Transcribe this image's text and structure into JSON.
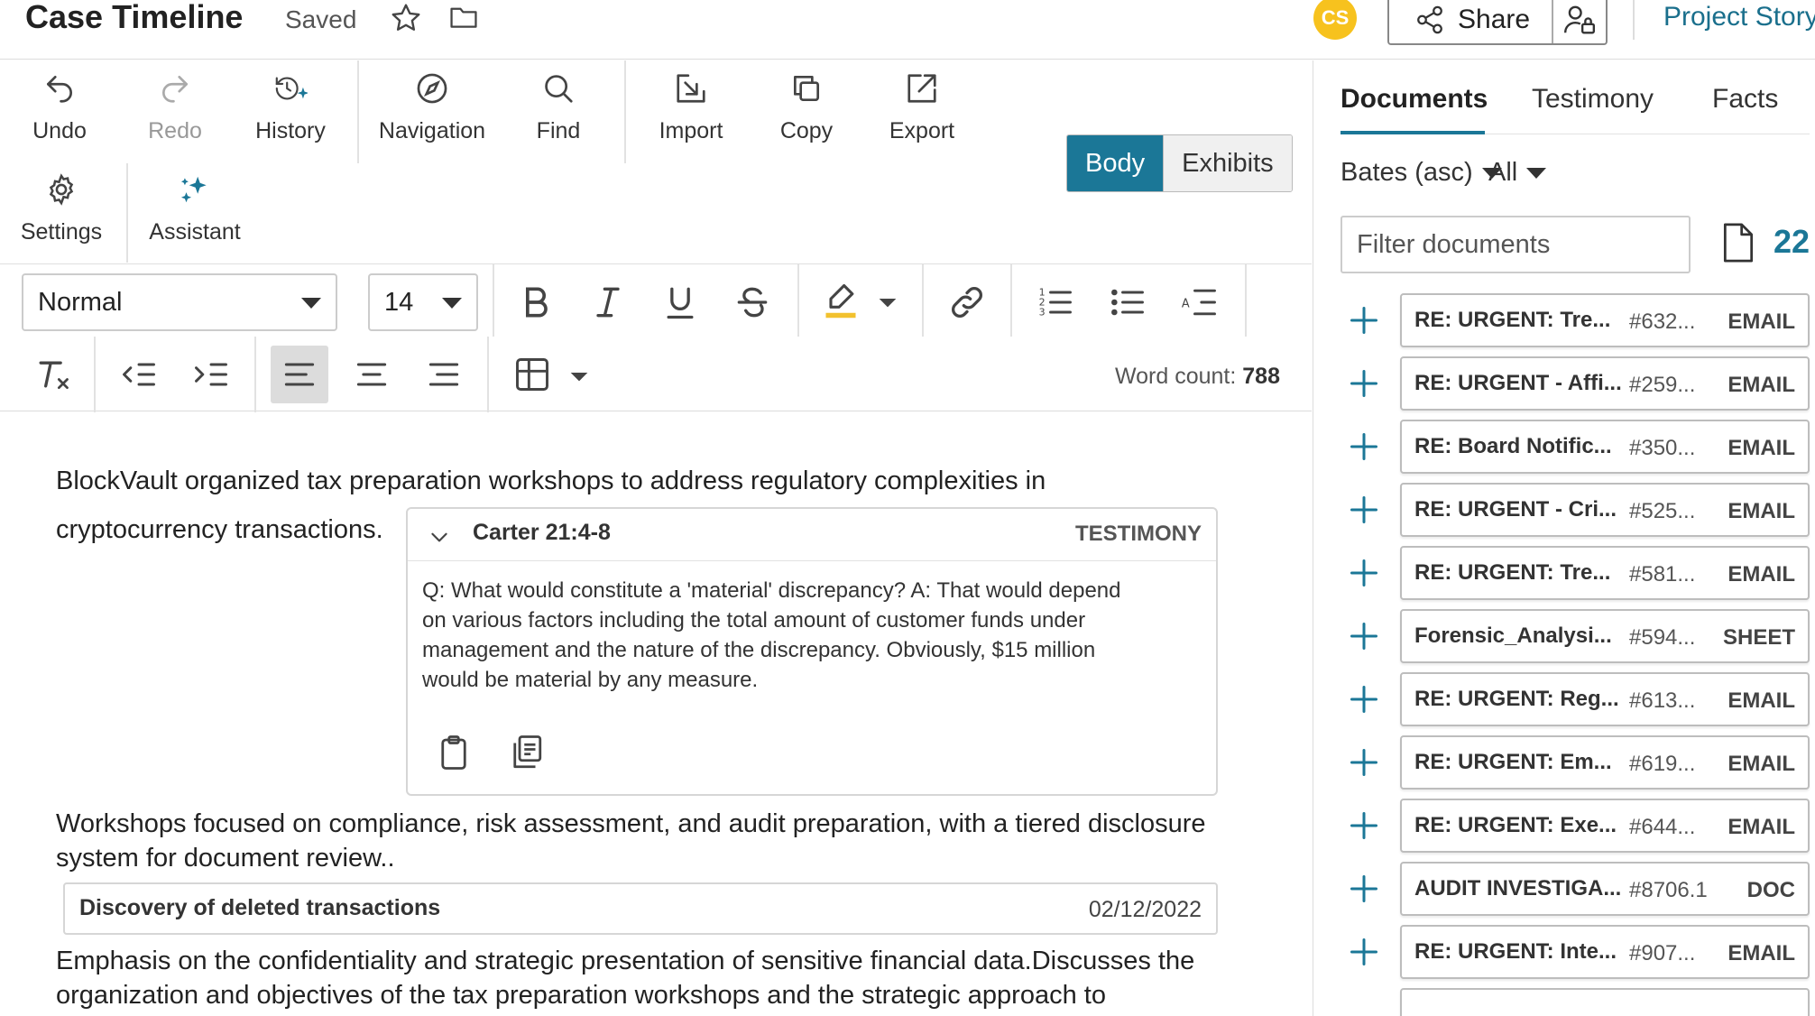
{
  "header": {
    "title": "Case Timeline",
    "status": "Saved",
    "avatar_initials": "CS",
    "share_label": "Share",
    "project_link": "Project Story",
    "accent_color": "#1b7797",
    "avatar_color": "#f7c21e"
  },
  "toolbar": {
    "undo": "Undo",
    "redo": "Redo",
    "history": "History",
    "navigation": "Navigation",
    "find": "Find",
    "import": "Import",
    "copy": "Copy",
    "export": "Export",
    "settings": "Settings",
    "assistant": "Assistant",
    "view_toggle": {
      "body": "Body",
      "exhibits": "Exhibits",
      "selected": "Body"
    }
  },
  "format": {
    "style": "Normal",
    "font_size": "14",
    "word_count_label": "Word count: ",
    "word_count": "788"
  },
  "document": {
    "para1_line1": "BlockVault organized tax preparation workshops to address regulatory complexities in",
    "para1_line2": "cryptocurrency transactions.",
    "testimony": {
      "citation": "Carter 21:4-8",
      "type": "TESTIMONY",
      "lines": [
        "Q:   What would constitute a 'material' discrepancy? A:   That would depend",
        "on various factors including the total amount of customer funds under",
        "management and the nature of the discrepancy.   Obviously, $15 million",
        "would be material by any measure."
      ]
    },
    "para2_line1": "Workshops focused on compliance, risk assessment, and audit preparation, with a tiered disclosure",
    "para2_line2": "system for document review..",
    "event": {
      "title": "Discovery of deleted transactions",
      "date": "02/12/2022"
    },
    "para3_line1": "Emphasis on the confidentiality and strategic presentation of sensitive financial data.Discusses the",
    "para3_line2": "organization and objectives of the tax preparation workshops and the strategic approach to"
  },
  "sidebar": {
    "tabs": [
      "Documents",
      "Testimony",
      "Facts"
    ],
    "active_tab": "Documents",
    "sort": "Bates (asc)",
    "filter_scope": "All",
    "filter_placeholder": "Filter documents",
    "count": "22",
    "documents": [
      {
        "title": "RE: URGENT: Tre...",
        "num": "#632...",
        "type": "EMAIL"
      },
      {
        "title": "RE: URGENT - Affi...",
        "num": "#259...",
        "type": "EMAIL"
      },
      {
        "title": "RE: Board Notific...",
        "num": "#350...",
        "type": "EMAIL"
      },
      {
        "title": "RE: URGENT - Cri...",
        "num": "#525...",
        "type": "EMAIL"
      },
      {
        "title": "RE: URGENT: Tre...",
        "num": "#581...",
        "type": "EMAIL"
      },
      {
        "title": "Forensic_Analysi...",
        "num": "#594...",
        "type": "SHEET"
      },
      {
        "title": "RE: URGENT: Reg...",
        "num": "#613...",
        "type": "EMAIL"
      },
      {
        "title": "RE: URGENT: Em...",
        "num": "#619...",
        "type": "EMAIL"
      },
      {
        "title": "RE: URGENT: Exe...",
        "num": "#644...",
        "type": "EMAIL"
      },
      {
        "title": "AUDIT INVESTIGA...",
        "num": "#8706.1",
        "type": "DOC"
      },
      {
        "title": "RE: URGENT: Inte...",
        "num": "#907...",
        "type": "EMAIL"
      }
    ]
  }
}
